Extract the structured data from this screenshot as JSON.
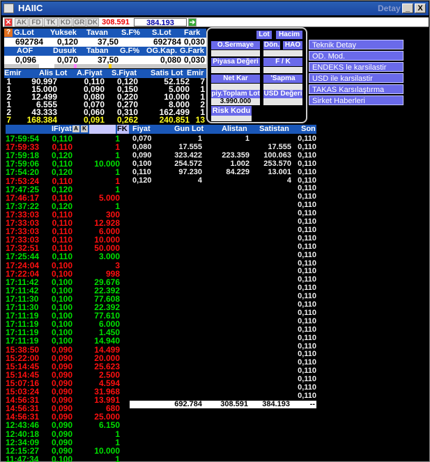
{
  "window": {
    "title": "HAIIC",
    "subtitle": "Detay",
    "min": "_",
    "max": "□",
    "close": "X"
  },
  "toolbar": {
    "items": [
      "AK",
      "FD",
      "TK",
      "KD",
      "GR",
      "DK"
    ],
    "value1": "308.591",
    "value2": "384.193"
  },
  "summary": {
    "head1": [
      "G.Lot",
      "Yuksek",
      "Tavan",
      "S.F%",
      "S.Lot",
      "Fark"
    ],
    "row1": [
      "692784",
      "0,120",
      "37,50",
      "692784",
      "0,030"
    ],
    "head2": [
      "AOF",
      "Dusuk",
      "Taban",
      "G.F%",
      "OG.Kap.",
      "G.Fark"
    ],
    "row2": [
      "0,096",
      "0,070",
      "37,50",
      "0,080",
      "0,030"
    ]
  },
  "popup": {
    "lot": "Lot",
    "hacim": "Hacim",
    "osermaye": "O.Sermaye",
    "don": "Dön.",
    "hao": "HAO",
    "piyasa": "Piyasa Değeri",
    "fk": "F / K",
    "netkar": "Net Kar",
    "sapma": "'Sapma",
    "piytoplam": "piy.Toplam Lot",
    "usd": "USD Değeri",
    "value": "3.990.000",
    "risk": "Risk Kodu"
  },
  "side_menu": [
    "Teknik Detay",
    "OD. Mod.",
    "ENDEKS le karsilastir",
    "USD ile karsilastir",
    "TAKAS Karsılaştırma",
    "Sirket Haberleri"
  ],
  "orderbook": {
    "headers": [
      "Emir",
      "Alis Lot",
      "A.Fiyat",
      "S.Fiyat",
      "Satis Lot",
      "Emir"
    ],
    "rows": [
      [
        "1",
        "90.997",
        "0,110",
        "0,120",
        "52.152",
        "7"
      ],
      [
        "1",
        "15.000",
        "0,090",
        "0,150",
        "5.000",
        "1"
      ],
      [
        "2",
        "12.499",
        "0,080",
        "0,220",
        "10.000",
        "1"
      ],
      [
        "1",
        "6.555",
        "0,070",
        "0,270",
        "8.000",
        "2"
      ],
      [
        "2",
        "43.333",
        "0,060",
        "0,310",
        "162.499",
        "1"
      ]
    ],
    "total": [
      "7",
      "168.384",
      "0,091",
      "0,262",
      "240.851",
      "13"
    ]
  },
  "trades": {
    "headers": [
      "IFiyat",
      "A",
      "K",
      "FK"
    ],
    "rows": [
      [
        "17:59:54",
        "0,110",
        "1",
        "g"
      ],
      [
        "17:59:33",
        "0,110",
        "1",
        "r"
      ],
      [
        "17:59:18",
        "0,120",
        "1",
        "g"
      ],
      [
        "17:59:06",
        "0,110",
        "10.000",
        "g"
      ],
      [
        "17:54:20",
        "0,120",
        "1",
        "g"
      ],
      [
        "17:53:24",
        "0,110",
        "1",
        "r"
      ],
      [
        "17:47:25",
        "0,120",
        "1",
        "g"
      ],
      [
        "17:46:17",
        "0,110",
        "5.000",
        "r"
      ],
      [
        "17:37:22",
        "0,120",
        "1",
        "g"
      ],
      [
        "17:33:03",
        "0,110",
        "300",
        "r"
      ],
      [
        "17:33:03",
        "0,110",
        "12.928",
        "r"
      ],
      [
        "17:33:03",
        "0,110",
        "6.000",
        "r"
      ],
      [
        "17:33:03",
        "0,110",
        "10.000",
        "r"
      ],
      [
        "17:32:51",
        "0,110",
        "50.000",
        "r"
      ],
      [
        "17:25:44",
        "0,110",
        "3.000",
        "g"
      ],
      [
        "17:24:04",
        "0,100",
        "3",
        "r"
      ],
      [
        "17:22:04",
        "0,100",
        "998",
        "r"
      ],
      [
        "17:11:42",
        "0,100",
        "29.676",
        "g"
      ],
      [
        "17:11:42",
        "0,100",
        "22.392",
        "g"
      ],
      [
        "17:11:30",
        "0,100",
        "77.608",
        "g"
      ],
      [
        "17:11:30",
        "0,100",
        "22.392",
        "g"
      ],
      [
        "17:11:19",
        "0,100",
        "77.610",
        "g"
      ],
      [
        "17:11:19",
        "0,100",
        "6.000",
        "g"
      ],
      [
        "17:11:19",
        "0,100",
        "1.450",
        "g"
      ],
      [
        "17:11:19",
        "0,100",
        "14.940",
        "g"
      ],
      [
        "15:38:50",
        "0,090",
        "14.499",
        "r"
      ],
      [
        "15:22:00",
        "0,090",
        "20.000",
        "r"
      ],
      [
        "15:14:45",
        "0,090",
        "25.623",
        "r"
      ],
      [
        "15:14:45",
        "0,090",
        "2.500",
        "r"
      ],
      [
        "15:07:16",
        "0,090",
        "4.594",
        "r"
      ],
      [
        "15:03:24",
        "0,090",
        "31.968",
        "r"
      ],
      [
        "14:56:31",
        "0,090",
        "13.991",
        "r"
      ],
      [
        "14:56:31",
        "0,090",
        "680",
        "r"
      ],
      [
        "14:56:31",
        "0,090",
        "25.000",
        "r"
      ],
      [
        "12:43:46",
        "0,090",
        "6.150",
        "g"
      ],
      [
        "12:40:18",
        "0,090",
        "1",
        "g"
      ],
      [
        "12:34:09",
        "0,090",
        "1",
        "g"
      ],
      [
        "12:15:27",
        "0,090",
        "10.000",
        "g"
      ],
      [
        "11:47:34",
        "0,100",
        "1",
        "g"
      ]
    ]
  },
  "depth": {
    "headers": [
      "Fiyat",
      "Gun Lot",
      "Alistan",
      "Satistan",
      "Son"
    ],
    "rows": [
      [
        "0,070",
        "1",
        "1",
        ""
      ],
      [
        "0,080",
        "17.555",
        "",
        "17.555"
      ],
      [
        "0,090",
        "323.422",
        "223.359",
        "100.063"
      ],
      [
        "0,100",
        "254.572",
        "1.002",
        "253.570"
      ],
      [
        "0,110",
        "97.230",
        "84.229",
        "13.001"
      ],
      [
        "0,120",
        "4",
        "",
        "4"
      ]
    ],
    "son": "0,110",
    "totals": [
      "692.784",
      "308.591",
      "384.193",
      "--"
    ]
  }
}
